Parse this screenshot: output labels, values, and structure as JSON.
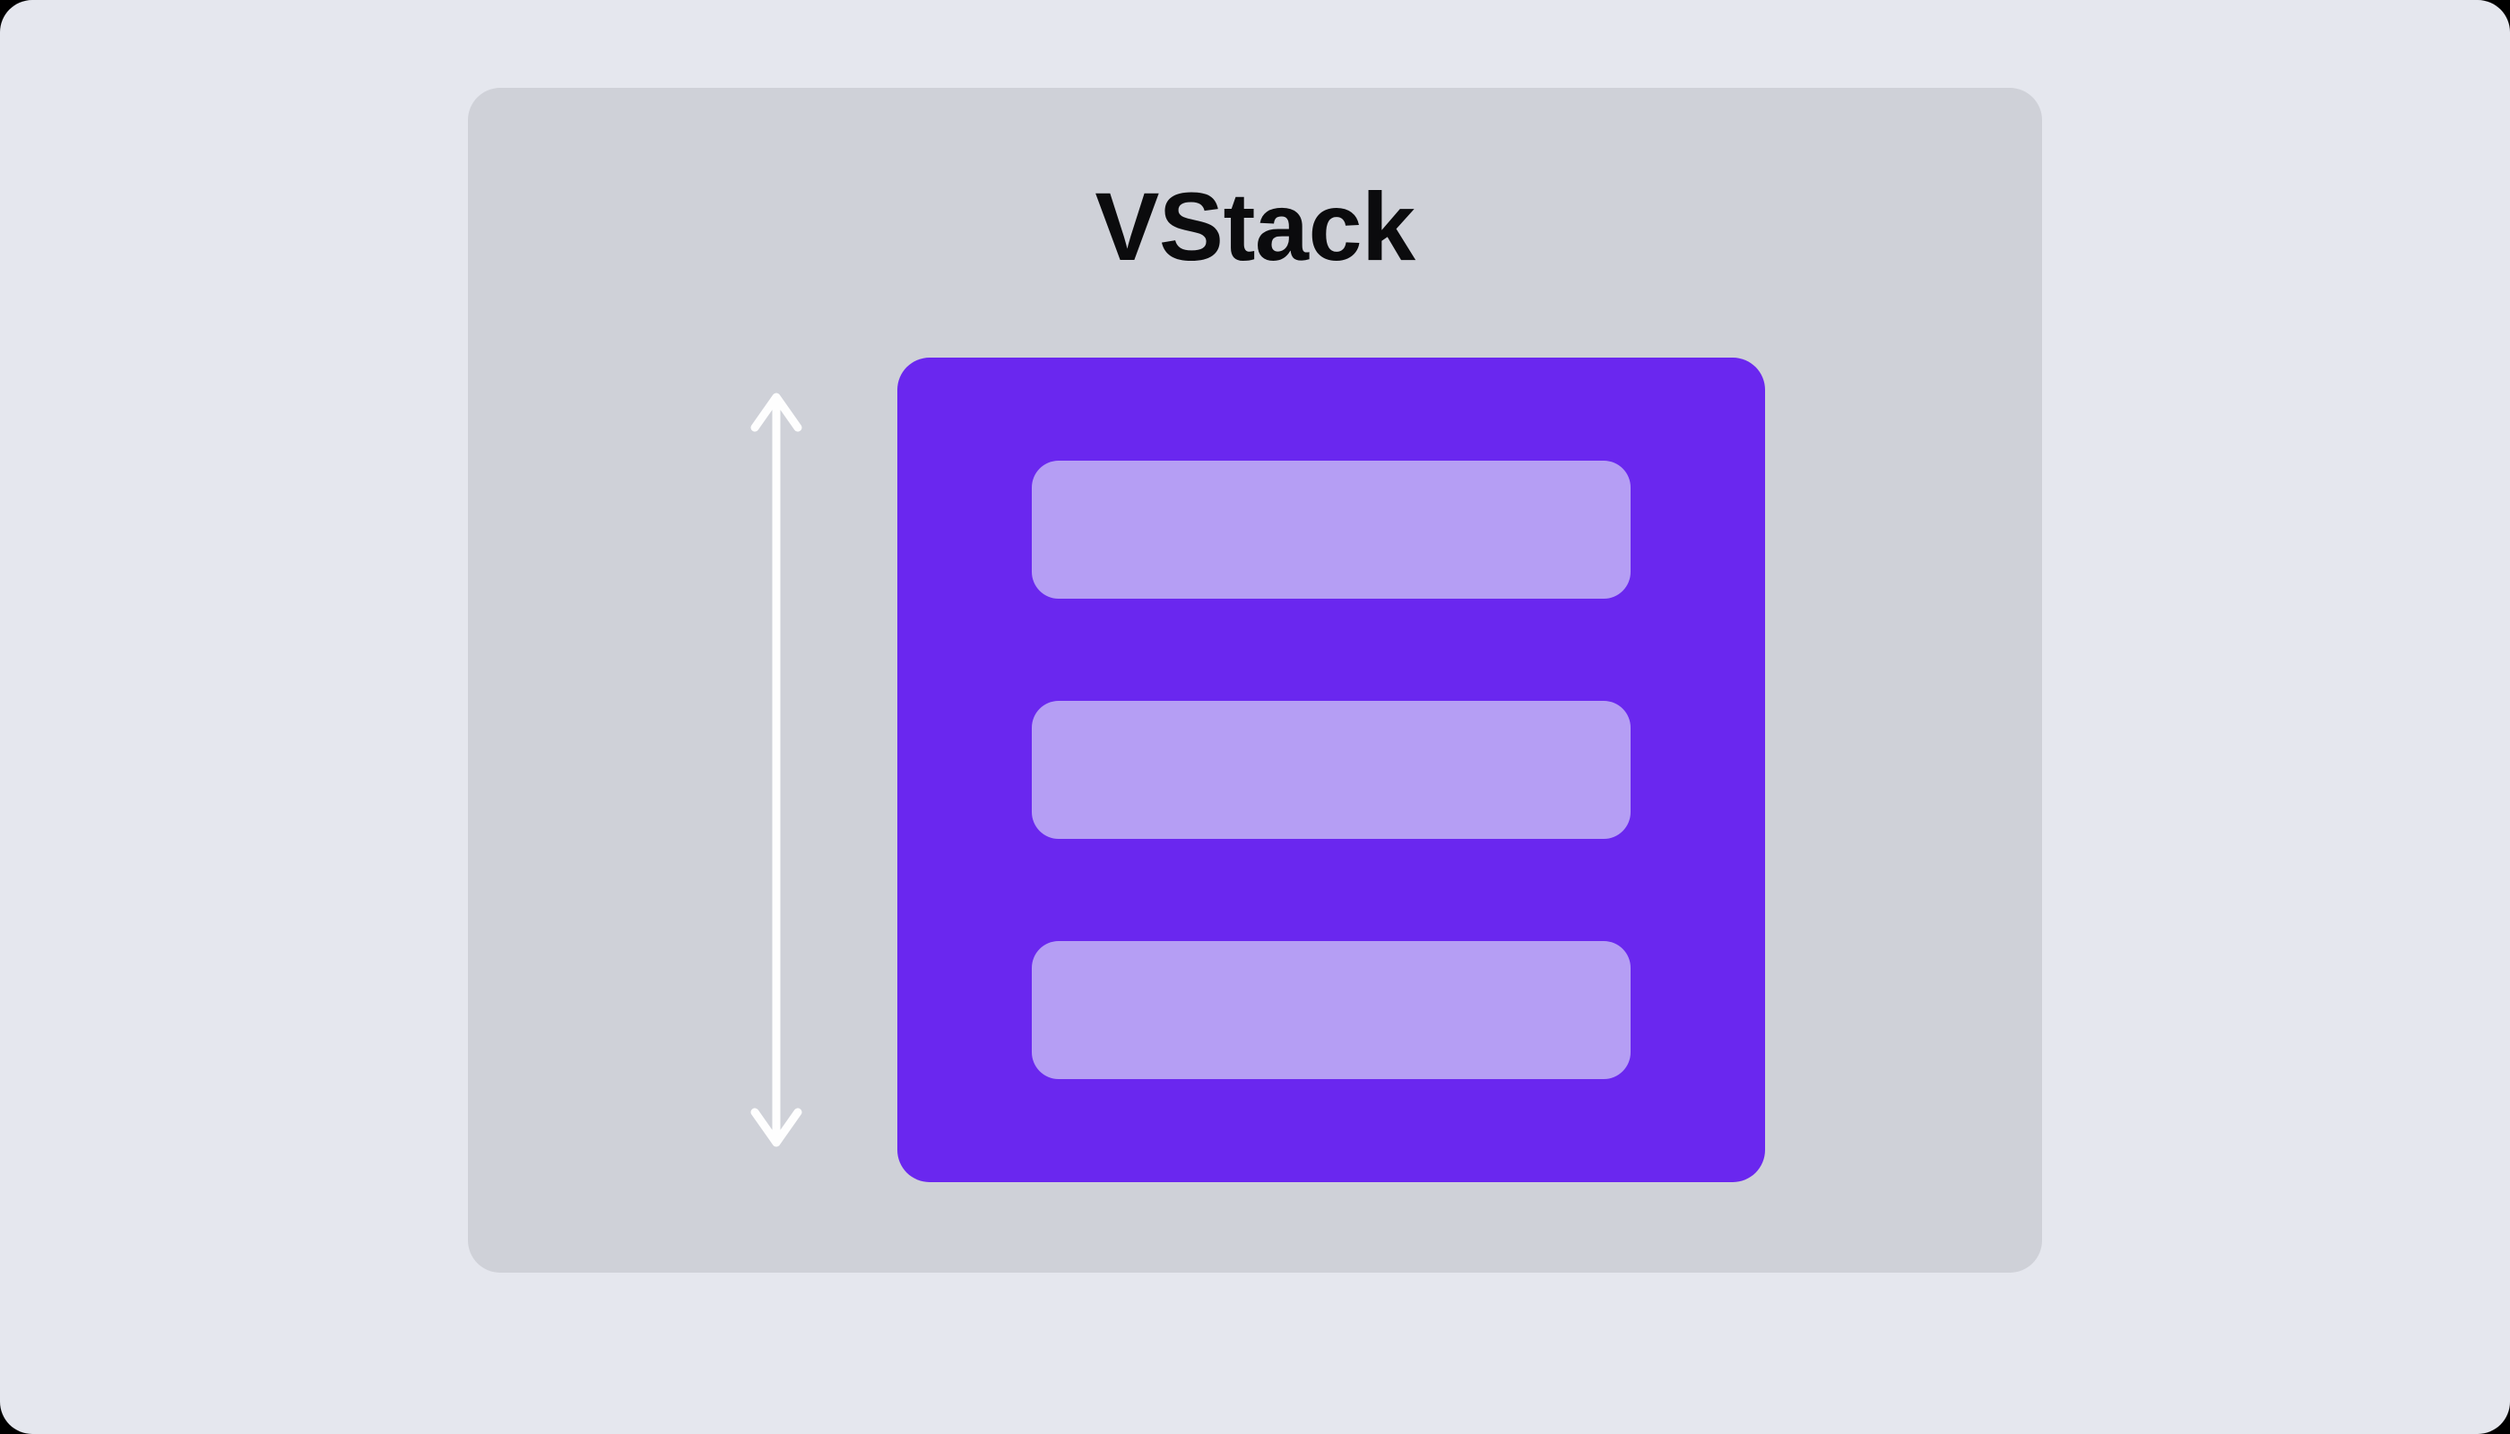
{
  "diagram": {
    "title": "VStack",
    "item_count": 3,
    "colors": {
      "page_bg": "#e5e7ee",
      "card_bg": "#cfd1d8",
      "vstack_bg": "#6a27ef",
      "item_bg": "#b59ef4",
      "arrow": "#fefefe",
      "title": "#0b0b0d"
    }
  }
}
